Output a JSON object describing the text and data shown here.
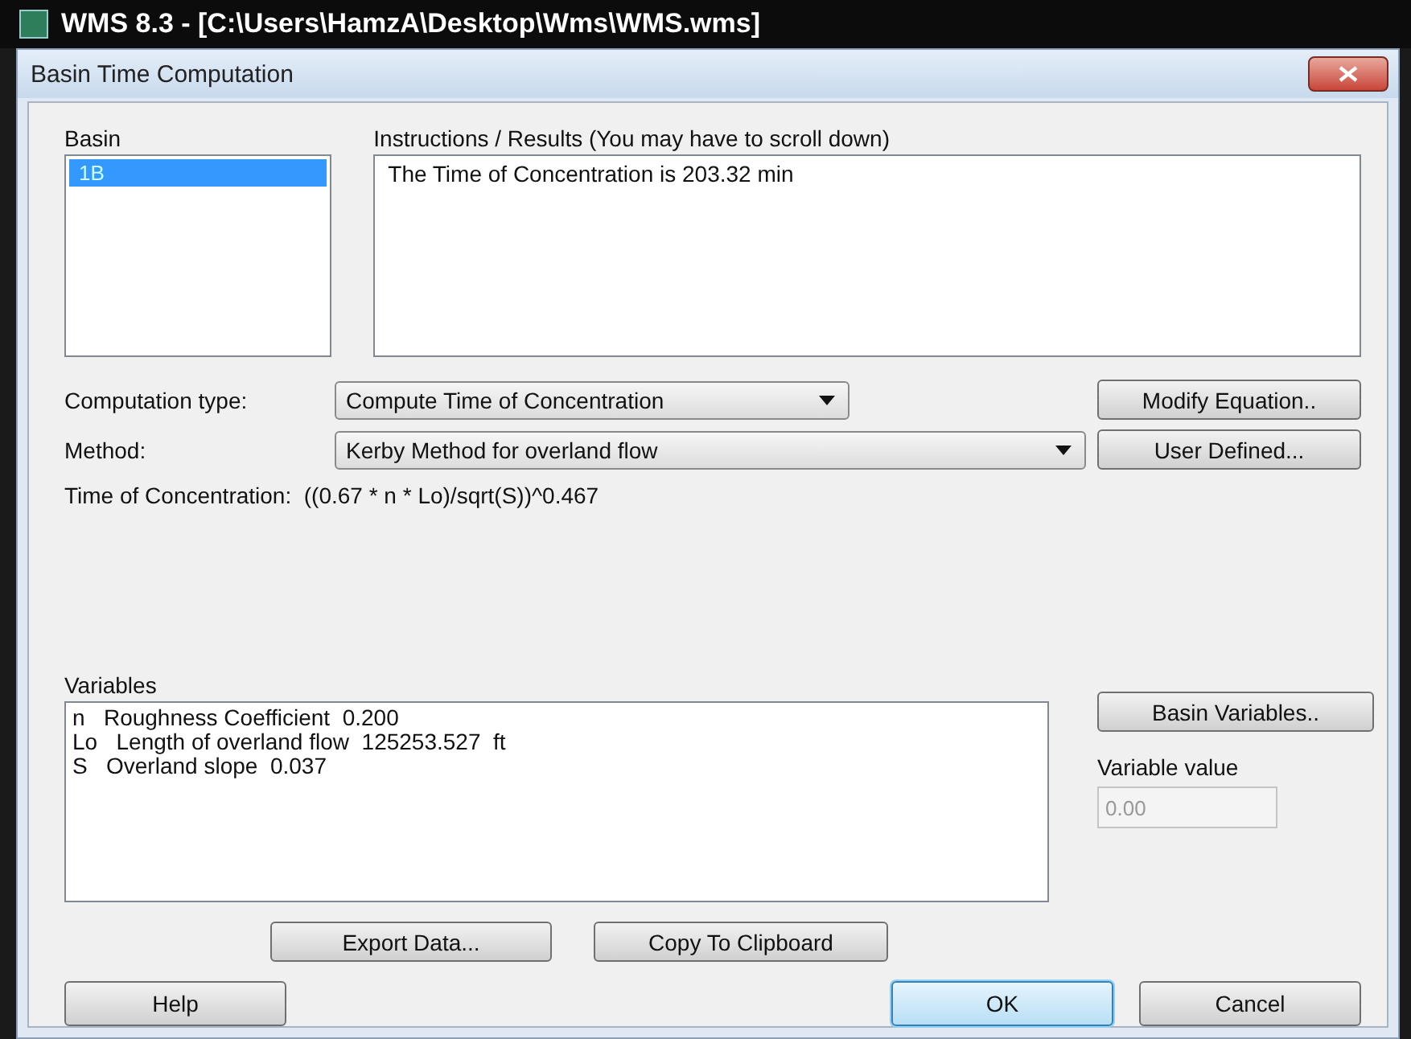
{
  "app_window": {
    "title": "WMS 8.3 - [C:\\Users\\HamzA\\Desktop\\Wms\\WMS.wms]"
  },
  "dialog": {
    "title": "Basin Time Computation",
    "basin_label": "Basin",
    "basins": [
      {
        "label": "1B",
        "selected": true
      }
    ],
    "results_label": "Instructions / Results  (You may have to scroll down)",
    "results_lines": [
      "The Time of Concentration is 203.32 min"
    ],
    "computation_type": {
      "label": "Computation type:",
      "value": "Compute Time of Concentration"
    },
    "method": {
      "label": "Method:",
      "value": "Kerby Method for overland flow"
    },
    "modify_button": "Modify Equation..",
    "user_defined_button": "User Defined...",
    "formula": "Time of Concentration:  ((0.67 * n * Lo)/sqrt(S))^0.467",
    "variables_label": "Variables",
    "variables": [
      "n   Roughness Coefficient  0.200",
      "Lo   Length of overland flow  125253.527  ft",
      "S   Overland slope  0.037"
    ],
    "basin_variables_button": "Basin Variables..",
    "variable_value": {
      "label": "Variable value",
      "value": "0.00",
      "disabled": true
    },
    "export_button": "Export Data...",
    "copy_button": "Copy To Clipboard",
    "footer_buttons": [
      {
        "label": "Help",
        "default": false
      },
      {
        "label": "OK",
        "default": true
      },
      {
        "label": "Cancel",
        "default": false
      }
    ]
  }
}
